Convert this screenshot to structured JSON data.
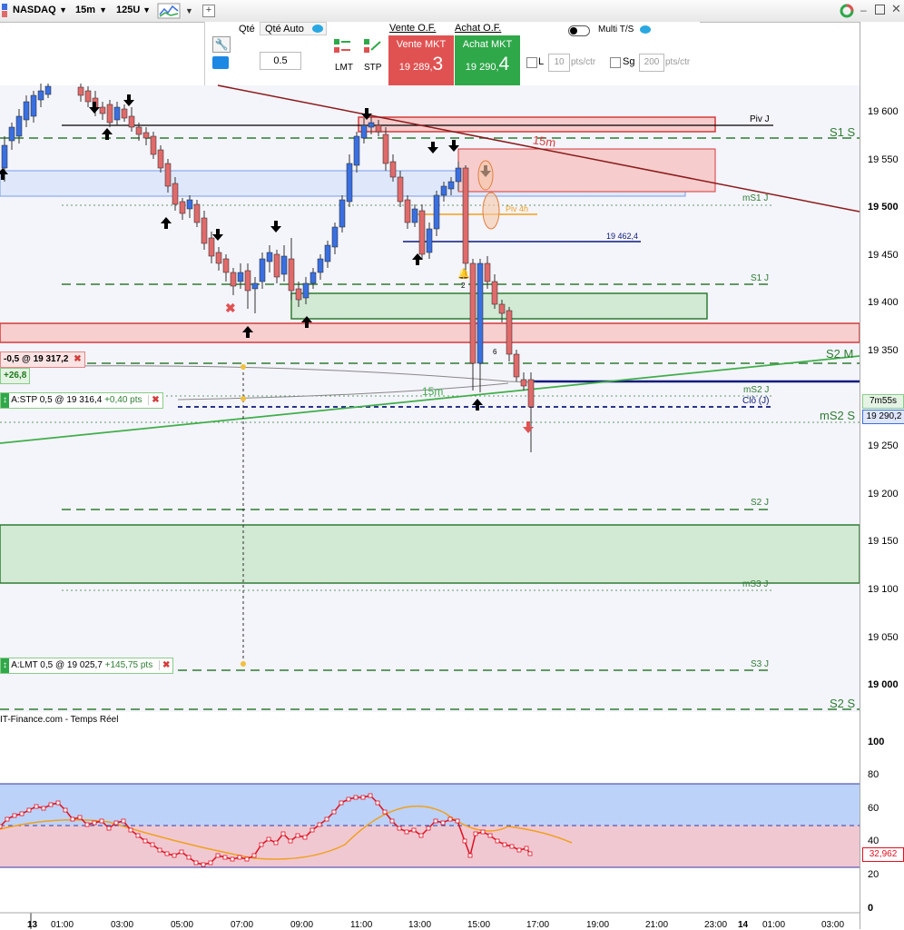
{
  "toolbar": {
    "symbol": "NASDAQ",
    "timeframe": "15m",
    "units": "125U"
  },
  "order_panel": {
    "qty_label": "Qté",
    "qty_auto_label": "Qté Auto",
    "qty_value": "0.5",
    "lmt_label": "LMT",
    "stp_label": "STP",
    "sell_of_label": "Vente O.F.",
    "buy_of_label": "Achat O.F.",
    "sell_mkt_label": "Vente MKT",
    "sell_price_main": "19 289,",
    "sell_price_digit": "3",
    "buy_mkt_label": "Achat MKT",
    "buy_price_main": "19 290,",
    "buy_price_digit": "4",
    "multi_ts_label": "Multi T/S",
    "l_label": "L",
    "l_value": "10",
    "l_unit": "pts/ctr",
    "sg_label": "Sg",
    "sg_value": "200",
    "sg_unit": "pts/ctr"
  },
  "price_axis": {
    "labels": [
      "19 600",
      "19 550",
      "19 500",
      "19 450",
      "19 400",
      "19 350",
      "19 300",
      "19 250",
      "19 200",
      "19 150",
      "19 100",
      "19 050",
      "19 000"
    ],
    "timer": "7m55s",
    "last_price": "19 290,2"
  },
  "levels": {
    "piv_j": "Piv J",
    "s1_s": "S1 S",
    "ms1_j": "mS1 J",
    "s1_j": "S1 J",
    "s2_m": "S2 M",
    "ms2_j": "mS2 J",
    "clo_j": "Clô (J)",
    "ms2_s": "mS2 S",
    "s2_j": "S2 J",
    "ms3_j": "mS3 J",
    "s3_j": "S3 J",
    "s2_s": "S2 S",
    "hline_price": "19 462,4",
    "piv_4h": "Piv 4h",
    "tf_15m_a": "15m",
    "tf_15m_b": "15m",
    "marker_2": "2",
    "marker_6": "6"
  },
  "positions": {
    "pos_qty": "-0,5",
    "pos_at": "@",
    "pos_price": "19 317,2",
    "pos_pnl": "+26,8",
    "stp_label": "A:STP",
    "stp_qty": "0,5",
    "stp_at": "@",
    "stp_price": "19 316,4",
    "stp_pts": "+0,40",
    "stp_unit": "pts",
    "lmt_label": "A:LMT",
    "lmt_qty": "0,5",
    "lmt_at": "@",
    "lmt_price": "19 025,7",
    "lmt_pts": "+145,75",
    "lmt_unit": "pts"
  },
  "source": "IT-Finance.com - Temps Réel",
  "oscillator": {
    "labels": [
      "100",
      "80",
      "60",
      "40",
      "20",
      "0"
    ],
    "value": "32,962"
  },
  "time_axis": {
    "labels": [
      "13",
      "01:00",
      "03:00",
      "05:00",
      "07:00",
      "09:00",
      "11:00",
      "13:00",
      "15:00",
      "17:00",
      "19:00",
      "21:00",
      "23:00",
      "14",
      "01:00",
      "03:00"
    ]
  },
  "colors": {
    "up": "#3a6fe0",
    "down": "#e06a6a",
    "sell": "#e05252",
    "buy": "#2fa84a",
    "level_green": "#2e7d32",
    "trendline": "#8b1a1a",
    "close_line": "#0d1a7a"
  }
}
